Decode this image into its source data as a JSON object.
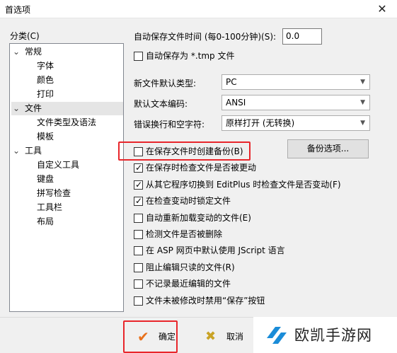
{
  "window": {
    "title": "首选项",
    "close_glyph": "✕"
  },
  "category": {
    "label": "分类(C)",
    "tree": [
      {
        "label": "常规",
        "level": 0,
        "expanded": true,
        "selected": false
      },
      {
        "label": "字体",
        "level": 1,
        "selected": false
      },
      {
        "label": "颜色",
        "level": 1,
        "selected": false
      },
      {
        "label": "打印",
        "level": 1,
        "selected": false
      },
      {
        "label": "文件",
        "level": 0,
        "expanded": true,
        "selected": true
      },
      {
        "label": "文件类型及语法",
        "level": 1,
        "selected": false
      },
      {
        "label": "模板",
        "level": 1,
        "selected": false
      },
      {
        "label": "工具",
        "level": 0,
        "expanded": true,
        "selected": false
      },
      {
        "label": "自定义工具",
        "level": 1,
        "selected": false
      },
      {
        "label": "键盘",
        "level": 1,
        "selected": false
      },
      {
        "label": "拼写检查",
        "level": 1,
        "selected": false
      },
      {
        "label": "工具栏",
        "level": 1,
        "selected": false
      },
      {
        "label": "布局",
        "level": 1,
        "selected": false
      }
    ]
  },
  "autosave": {
    "label": "自动保存文件时间 (每0-100分钟)(S):",
    "value": "0.0",
    "as_tmp_label": "自动保存为 *.tmp 文件",
    "as_tmp_checked": false
  },
  "selects": [
    {
      "label": "新文件默认类型:",
      "value": "PC"
    },
    {
      "label": "默认文本编码:",
      "value": "ANSI"
    },
    {
      "label": "错误换行和空字符:",
      "value": "原样打开 (无转换)"
    }
  ],
  "backup_options_button": "备份选项...",
  "checkboxes": [
    {
      "label": "在保存文件时创建备份(B)",
      "checked": false
    },
    {
      "label": "在保存时检查文件是否被更动",
      "checked": true
    },
    {
      "label": "从其它程序切换到 EditPlus 时检查文件是否变动(F)",
      "checked": true
    },
    {
      "label": "在检查变动时锁定文件",
      "checked": true
    },
    {
      "label": "自动重新加载变动的文件(E)",
      "checked": false
    },
    {
      "label": "检测文件是否被删除",
      "checked": false
    },
    {
      "label": "在 ASP 网页中默认使用 JScript 语言",
      "checked": false
    },
    {
      "label": "阻止编辑只读的文件(R)",
      "checked": false
    },
    {
      "label": "不记录最近编辑的文件",
      "checked": false
    },
    {
      "label": "文件未被修改时禁用“保存”按钮",
      "checked": false
    }
  ],
  "footer": {
    "ok_label": "确定",
    "ok_icon": "checkmark-icon",
    "cancel_label": "取消",
    "cancel_icon": "cross-icon"
  },
  "watermark": {
    "text": "欧凯手游网"
  },
  "colors": {
    "highlight": "#e8262b",
    "ok_icon": "#e8711c",
    "cancel_icon": "#c9a326",
    "logo": "#1a8cd8"
  }
}
